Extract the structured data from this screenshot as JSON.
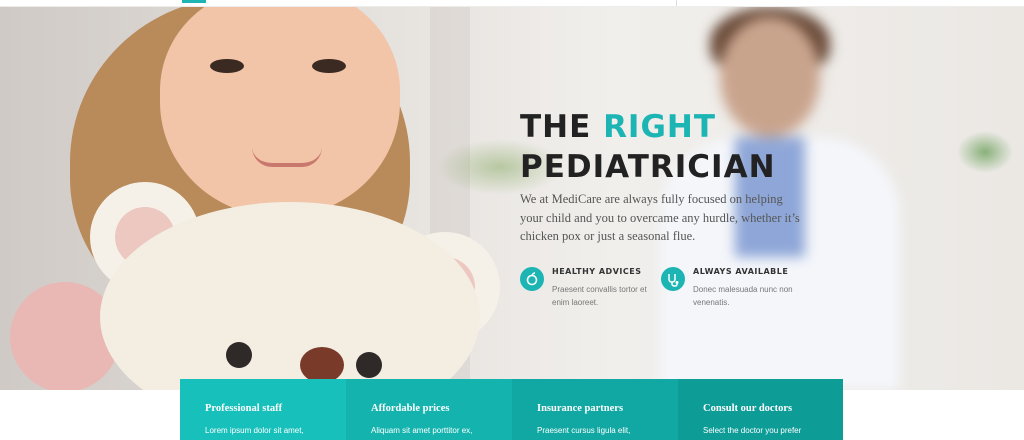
{
  "hero": {
    "headline_part1": "THE ",
    "headline_highlight": "RIGHT",
    "headline_line2": "PEDIATRICIAN",
    "description": "We at MediCare are always fully focused on helping your child and you to overcame any hurdle, whether it’s chicken pox or just a seasonal flue.",
    "accent_color": "#1cb5b3",
    "features": [
      {
        "icon": "apple-icon",
        "title": "HEALTHY ADVICES",
        "description": "Praesent convallis tortor et enim laoreet."
      },
      {
        "icon": "stethoscope-icon",
        "title": "ALWAYS AVAILABLE",
        "description": "Donec malesuada nunc non venenatis."
      }
    ]
  },
  "services": [
    {
      "title": "Professional staff",
      "description": "Lorem ipsum dolor sit amet,"
    },
    {
      "title": "Affordable prices",
      "description": "Aliquam sit amet porttitor ex,"
    },
    {
      "title": "Insurance partners",
      "description": "Praesent cursus ligula elit,"
    },
    {
      "title": "Consult our doctors",
      "description": "Select the doctor you prefer"
    }
  ]
}
